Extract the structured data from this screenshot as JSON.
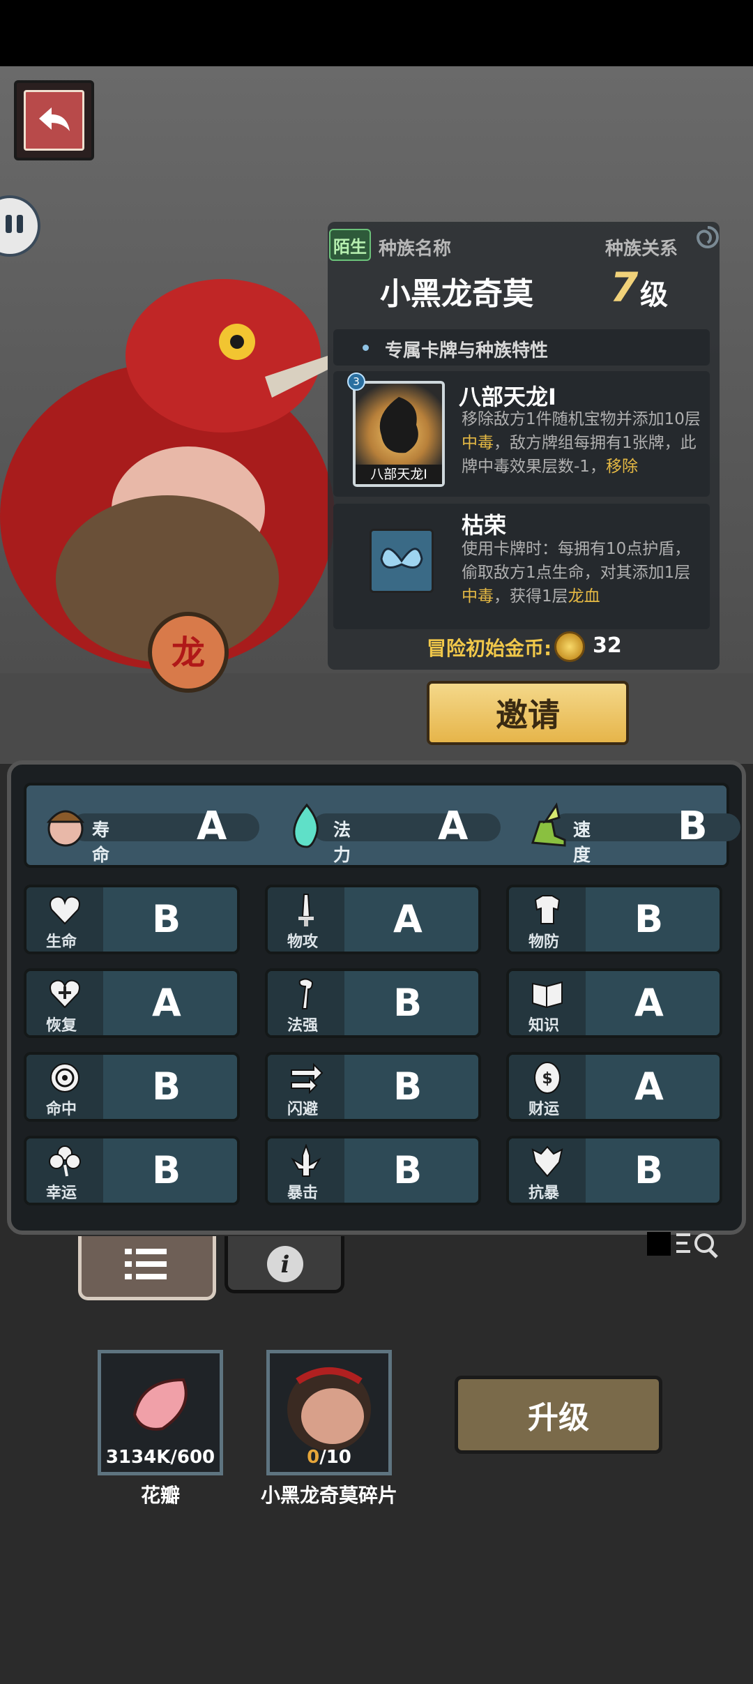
{
  "race_info": {
    "tag": "陌生",
    "name_label": "种族名称",
    "relation_label": "种族关系",
    "name": "小黑龙奇莫",
    "level_num": "7",
    "level_suffix": "级",
    "section_title": "专属卡牌与种族特性"
  },
  "cards": [
    {
      "badge": "3",
      "caption": "八部天龙Ⅰ",
      "title": "八部天龙Ⅰ",
      "desc_1": "移除敌方1件随机宝物并添加10层",
      "desc_hl1": "中毒",
      "desc_2": "，敌方牌组每拥有1张牌，此牌中毒效果层数-1，",
      "desc_hl2": "移除"
    },
    {
      "title": "枯荣",
      "desc_1": "使用卡牌时：每拥有10点护盾，偷取敌方1点生命，对其添加1层",
      "desc_hl1": "中毒",
      "desc_2": "，获得1层",
      "desc_hl2": "龙血"
    }
  ],
  "gold": {
    "label": "冒险初始金币:",
    "value": "32"
  },
  "invite_label": "邀请",
  "top_stats": [
    {
      "name": "寿命",
      "grade": "A"
    },
    {
      "name": "法力",
      "grade": "A"
    },
    {
      "name": "速度",
      "grade": "B"
    }
  ],
  "stats": [
    {
      "name": "生命",
      "grade": "B",
      "icon": "heart-icon"
    },
    {
      "name": "物攻",
      "grade": "A",
      "icon": "sword-icon"
    },
    {
      "name": "物防",
      "grade": "B",
      "icon": "armor-icon"
    },
    {
      "name": "恢复",
      "grade": "A",
      "icon": "heal-heart-icon"
    },
    {
      "name": "法强",
      "grade": "B",
      "icon": "staff-icon"
    },
    {
      "name": "知识",
      "grade": "A",
      "icon": "book-icon"
    },
    {
      "name": "命中",
      "grade": "B",
      "icon": "target-icon"
    },
    {
      "name": "闪避",
      "grade": "B",
      "icon": "dodge-arrows-icon"
    },
    {
      "name": "财运",
      "grade": "A",
      "icon": "coin-icon"
    },
    {
      "name": "幸运",
      "grade": "B",
      "icon": "clover-icon"
    },
    {
      "name": "暴击",
      "grade": "B",
      "icon": "crit-icon"
    },
    {
      "name": "抗暴",
      "grade": "B",
      "icon": "shield-crit-icon"
    }
  ],
  "materials": [
    {
      "name": "花瓣",
      "qty_have": "3134K",
      "qty_need": "/600",
      "icon": "petal-icon"
    },
    {
      "name": "小黑龙奇莫碎片",
      "qty_have": "0",
      "qty_need": "/10",
      "icon": "shard-icon"
    }
  ],
  "upgrade_label": "升级",
  "colors": {
    "accent_gold": "#e6b54a",
    "panel": "#2e4a56",
    "highlight": "#e5b944"
  }
}
